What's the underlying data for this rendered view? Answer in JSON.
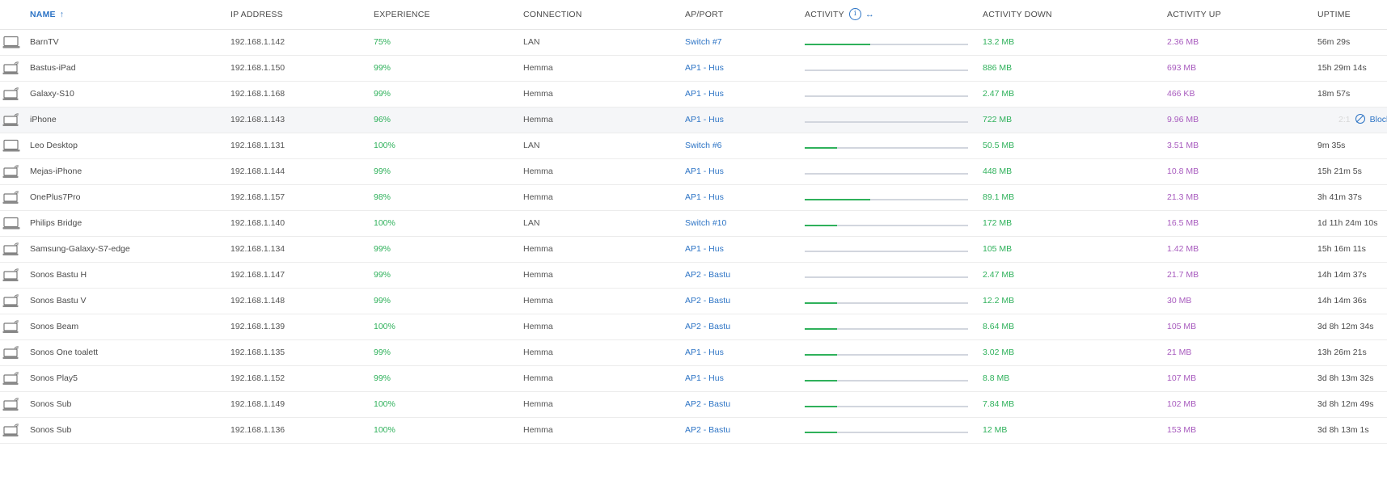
{
  "columns": {
    "name": "NAME",
    "sort_indicator": "↑",
    "ip": "IP ADDRESS",
    "experience": "EXPERIENCE",
    "connection": "CONNECTION",
    "ap_port": "AP/PORT",
    "activity": "ACTIVITY",
    "activity_info_icon": "i",
    "activity_expand_icon": "↔",
    "activity_down": "ACTIVITY DOWN",
    "activity_up": "ACTIVITY UP",
    "uptime": "UPTIME"
  },
  "colors": {
    "accent": "#2d74c5",
    "experience": "#2fb15b",
    "down": "#2fb15b",
    "up": "#a85bbe",
    "bar_track": "#d2d6de"
  },
  "hover_row_action": {
    "uptime_partial": "2:1",
    "block_label": "Block"
  },
  "rows": [
    {
      "icon": "desktop-icon",
      "name": "BarnTV",
      "ip": "192.168.1.142",
      "experience": "75%",
      "connection": "LAN",
      "ap_port": "Switch #7",
      "activity_fraction": 0.4,
      "down": "13.2 MB",
      "up": "2.36 MB",
      "uptime": "56m 29s"
    },
    {
      "icon": "wifi-laptop-icon",
      "name": "Bastus-iPad",
      "ip": "192.168.1.150",
      "experience": "99%",
      "connection": "Hemma",
      "ap_port": "AP1 - Hus",
      "activity_fraction": 0,
      "down": "886 MB",
      "up": "693 MB",
      "uptime": "15h 29m 14s"
    },
    {
      "icon": "wifi-laptop-icon",
      "name": "Galaxy-S10",
      "ip": "192.168.1.168",
      "experience": "99%",
      "connection": "Hemma",
      "ap_port": "AP1 - Hus",
      "activity_fraction": 0,
      "down": "2.47 MB",
      "up": "466 KB",
      "uptime": "18m 57s"
    },
    {
      "icon": "wifi-laptop-icon",
      "name": "iPhone",
      "ip": "192.168.1.143",
      "experience": "96%",
      "connection": "Hemma",
      "ap_port": "AP1 - Hus",
      "activity_fraction": 0,
      "down": "722 MB",
      "up": "9.96 MB",
      "uptime": "",
      "hover": true
    },
    {
      "icon": "desktop-icon",
      "name": "Leo Desktop",
      "ip": "192.168.1.131",
      "experience": "100%",
      "connection": "LAN",
      "ap_port": "Switch #6",
      "activity_fraction": 0.2,
      "down": "50.5 MB",
      "up": "3.51 MB",
      "uptime": "9m 35s"
    },
    {
      "icon": "wifi-laptop-icon",
      "name": "Mejas-iPhone",
      "ip": "192.168.1.144",
      "experience": "99%",
      "connection": "Hemma",
      "ap_port": "AP1 - Hus",
      "activity_fraction": 0,
      "down": "448 MB",
      "up": "10.8 MB",
      "uptime": "15h 21m 5s"
    },
    {
      "icon": "wifi-laptop-icon",
      "name": "OnePlus7Pro",
      "ip": "192.168.1.157",
      "experience": "98%",
      "connection": "Hemma",
      "ap_port": "AP1 - Hus",
      "activity_fraction": 0.4,
      "down": "89.1 MB",
      "up": "21.3 MB",
      "uptime": "3h 41m 37s"
    },
    {
      "icon": "desktop-icon",
      "name": "Philips Bridge",
      "ip": "192.168.1.140",
      "experience": "100%",
      "connection": "LAN",
      "ap_port": "Switch #10",
      "activity_fraction": 0.2,
      "down": "172 MB",
      "up": "16.5 MB",
      "uptime": "1d 11h 24m 10s"
    },
    {
      "icon": "wifi-laptop-icon",
      "name": "Samsung-Galaxy-S7-edge",
      "ip": "192.168.1.134",
      "experience": "99%",
      "connection": "Hemma",
      "ap_port": "AP1 - Hus",
      "activity_fraction": 0,
      "down": "105 MB",
      "up": "1.42 MB",
      "uptime": "15h 16m 11s"
    },
    {
      "icon": "wifi-laptop-icon",
      "name": "Sonos Bastu H",
      "ip": "192.168.1.147",
      "experience": "99%",
      "connection": "Hemma",
      "ap_port": "AP2 - Bastu",
      "activity_fraction": 0,
      "down": "2.47 MB",
      "up": "21.7 MB",
      "uptime": "14h 14m 37s"
    },
    {
      "icon": "wifi-laptop-icon",
      "name": "Sonos Bastu V",
      "ip": "192.168.1.148",
      "experience": "99%",
      "connection": "Hemma",
      "ap_port": "AP2 - Bastu",
      "activity_fraction": 0.2,
      "down": "12.2 MB",
      "up": "30 MB",
      "uptime": "14h 14m 36s"
    },
    {
      "icon": "wifi-laptop-icon",
      "name": "Sonos Beam",
      "ip": "192.168.1.139",
      "experience": "100%",
      "connection": "Hemma",
      "ap_port": "AP2 - Bastu",
      "activity_fraction": 0.2,
      "down": "8.64 MB",
      "up": "105 MB",
      "uptime": "3d 8h 12m 34s"
    },
    {
      "icon": "wifi-laptop-icon",
      "name": "Sonos One toalett",
      "ip": "192.168.1.135",
      "experience": "99%",
      "connection": "Hemma",
      "ap_port": "AP1 - Hus",
      "activity_fraction": 0.2,
      "down": "3.02 MB",
      "up": "21 MB",
      "uptime": "13h 26m 21s"
    },
    {
      "icon": "wifi-laptop-icon",
      "name": "Sonos Play5",
      "ip": "192.168.1.152",
      "experience": "99%",
      "connection": "Hemma",
      "ap_port": "AP1 - Hus",
      "activity_fraction": 0.2,
      "down": "8.8 MB",
      "up": "107 MB",
      "uptime": "3d 8h 13m 32s"
    },
    {
      "icon": "wifi-laptop-icon",
      "name": "Sonos Sub",
      "ip": "192.168.1.149",
      "experience": "100%",
      "connection": "Hemma",
      "ap_port": "AP2 - Bastu",
      "activity_fraction": 0.2,
      "down": "7.84 MB",
      "up": "102 MB",
      "uptime": "3d 8h 12m 49s"
    },
    {
      "icon": "wifi-laptop-icon",
      "name": "Sonos Sub",
      "ip": "192.168.1.136",
      "experience": "100%",
      "connection": "Hemma",
      "ap_port": "AP2 - Bastu",
      "activity_fraction": 0.2,
      "down": "12 MB",
      "up": "153 MB",
      "uptime": "3d 8h 13m 1s"
    }
  ]
}
